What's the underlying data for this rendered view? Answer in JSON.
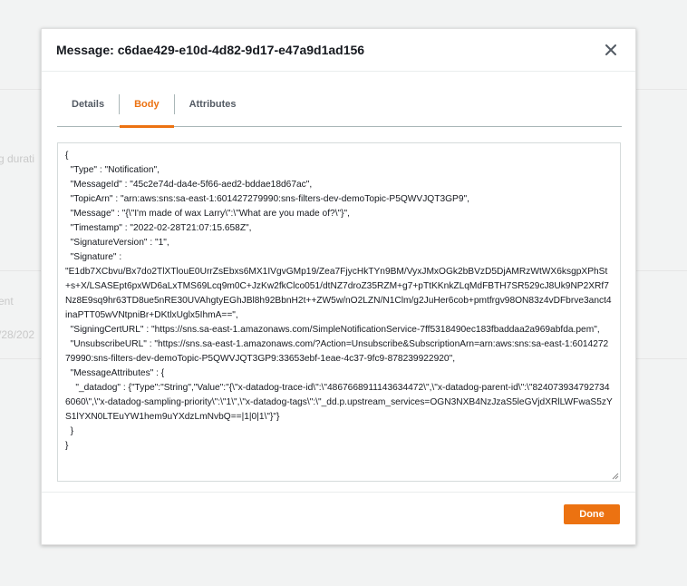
{
  "background": {
    "fragment_1": "g durati",
    "fragment_2": "ent",
    "fragment_3": "/28/202"
  },
  "modal": {
    "title": "Message: c6dae429-e10d-4d82-9d17-e47a9d1ad156",
    "close_icon": "close-icon",
    "tabs": [
      {
        "label": "Details",
        "active": false
      },
      {
        "label": "Body",
        "active": true
      },
      {
        "label": "Attributes",
        "active": false
      }
    ],
    "body_text": "{\n  \"Type\" : \"Notification\",\n  \"MessageId\" : \"45c2e74d-da4e-5f66-aed2-bddae18d67ac\",\n  \"TopicArn\" : \"arn:aws:sns:sa-east-1:601427279990:sns-filters-dev-demoTopic-P5QWVJQT3GP9\",\n  \"Message\" : \"{\\\"I'm made of wax Larry\\\":\\\"What are you made of?\\\"}\",\n  \"Timestamp\" : \"2022-02-28T21:07:15.658Z\",\n  \"SignatureVersion\" : \"1\",\n  \"Signature\" :\n\"E1db7XCbvu/Bx7do2TlXTlouE0UrrZsEbxs6MX1IVgvGMp19/Zea7FjycHkTYn9BM/VyxJMxOGk2bBVzD5DjAMRzWtWX6ksgpXPhSt+s+X/LSASEpt6pxWD6aLxTMS69Lcq9m0C+JzKw2fkClco051/dtNZ7droZ35RZM+g7+pTtKKnkZLqMdFBTH7SR529cJ8Uk9NP2XRf7Nz8E9sq9hr63TD8ue5nRE30UVAhgtyEGhJBl8h92BbnH2t++ZW5w/nO2LZN/N1Clm/g2JuHer6cob+pmtfrgv98ON83z4vDFbrve3anct4inaPTT05wVNtpniBr+DKtlxUglx5IhmA==\",\n  \"SigningCertURL\" : \"https://sns.sa-east-1.amazonaws.com/SimpleNotificationService-7ff5318490ec183fbaddaa2a969abfda.pem\",\n  \"UnsubscribeURL\" : \"https://sns.sa-east-1.amazonaws.com/?Action=Unsubscribe&SubscriptionArn=arn:aws:sns:sa-east-1:601427279990:sns-filters-dev-demoTopic-P5QWVJQT3GP9:33653ebf-1eae-4c37-9fc9-878239922920\",\n  \"MessageAttributes\" : {\n    \"_datadog\" : {\"Type\":\"String\",\"Value\":\"{\\\"x-datadog-trace-id\\\":\\\"4867668911143634472\\\",\\\"x-datadog-parent-id\\\":\\\"8240739347927346060\\\",\\\"x-datadog-sampling-priority\\\":\\\"1\\\",\\\"x-datadog-tags\\\":\\\"_dd.p.upstream_services=OGN3NXB4NzJzaS5leGVjdXRlLWFwaS5zYS1lYXN0LTEuYW1hem9uYXdzLmNvbQ==|1|0|1\\\"}\"}\n  }\n}",
    "done_label": "Done"
  },
  "colors": {
    "accent": "#ec7211",
    "tab_inactive": "#545b64",
    "text": "#16191f"
  }
}
